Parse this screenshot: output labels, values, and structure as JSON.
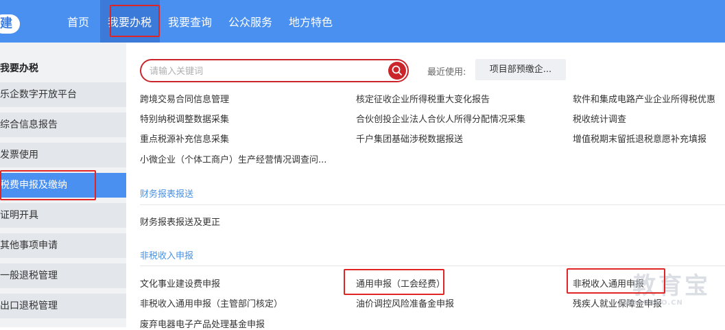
{
  "nav": {
    "logo": "建",
    "items": [
      "首页",
      "我要办税",
      "我要查询",
      "公众服务",
      "地方特色"
    ]
  },
  "sidebar": {
    "header": "我要办税",
    "items": [
      "乐企数字开放平台",
      "综合信息报告",
      "发票使用",
      "税费申报及缴纳",
      "证明开具",
      "其他事项申请",
      "一般退税管理",
      "出口退税管理"
    ],
    "active_index": 3
  },
  "search": {
    "placeholder": "请输入关键词",
    "recent_label": "最近使用:",
    "recent_item": "项目部预缴企..."
  },
  "tax_items": {
    "col1": [
      "跨境交易合同信息管理",
      "特别纳税调整数据采集",
      "重点税源补充信息采集",
      "小微企业（个体工商户）生产经营情况调查问..."
    ],
    "col2": [
      "核定征收企业所得税重大变化报告",
      "合伙创投企业法人合伙人所得分配情况采集",
      "千户集团基础涉税数据报送"
    ],
    "col3": [
      "软件和集成电路产业企业所得税优惠",
      "税收统计调查",
      "增值税期末留抵退税意愿补充填报"
    ]
  },
  "financial": {
    "title": "财务报表报送",
    "items": [
      "财务报表报送及更正"
    ]
  },
  "nontax": {
    "title": "非税收入申报",
    "col1": [
      "文化事业建设费申报",
      "非税收入通用申报（主管部门核定）",
      "废弃电器电子产品处理基金申报"
    ],
    "col2": [
      "通用申报（工会经费）",
      "油价调控风险准备金申报"
    ],
    "col3": [
      "非税收入通用申报",
      "残疾人就业保障金申报"
    ]
  },
  "watermark": {
    "brand": "教育宝",
    "url": "JIAOYUBAO.CN"
  },
  "colors": {
    "nav_bg": "#4a90f0",
    "accent_red": "#c9252b",
    "link_blue": "#4a90e2",
    "annotation_red": "#e02424"
  }
}
